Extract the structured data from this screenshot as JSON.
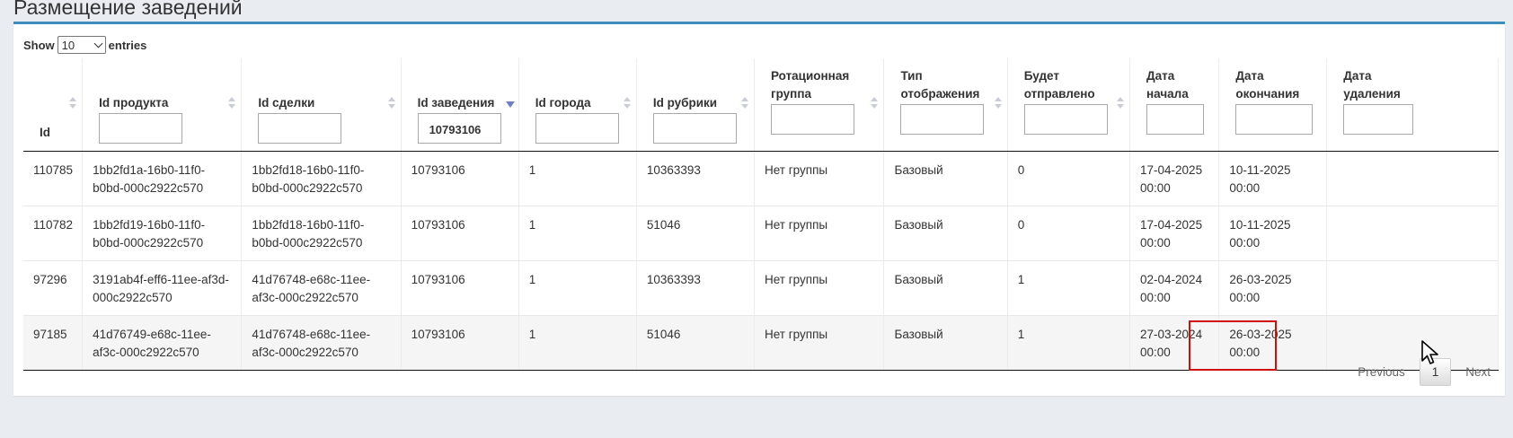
{
  "page": {
    "title": "Размещение заведений"
  },
  "length": {
    "show": "Show",
    "value": "10",
    "entries": "entries"
  },
  "table": {
    "columns": [
      {
        "label": "Id",
        "filter": null
      },
      {
        "label": "Id продукта",
        "filter": ""
      },
      {
        "label": "Id сделки",
        "filter": ""
      },
      {
        "label": "Id заведения",
        "filter": "10793106"
      },
      {
        "label": "Id города",
        "filter": ""
      },
      {
        "label": "Id рубрики",
        "filter": ""
      },
      {
        "label": "Ротационная группа",
        "filter": ""
      },
      {
        "label": "Тип отображения",
        "filter": ""
      },
      {
        "label": "Будет отправлено",
        "filter": ""
      },
      {
        "label": "Дата начала",
        "filter": ""
      },
      {
        "label": "Дата окончания",
        "filter": ""
      },
      {
        "label": "Дата удаления",
        "filter": ""
      }
    ],
    "rows": [
      [
        "110785",
        "1bb2fd1a-16b0-11f0-b0bd-000c2922c570",
        "1bb2fd18-16b0-11f0-b0bd-000c2922c570",
        "10793106",
        "1",
        "10363393",
        "Нет группы",
        "Базовый",
        "0",
        "17-04-2025 00:00",
        "10-11-2025 00:00",
        ""
      ],
      [
        "110782",
        "1bb2fd19-16b0-11f0-b0bd-000c2922c570",
        "1bb2fd18-16b0-11f0-b0bd-000c2922c570",
        "10793106",
        "1",
        "51046",
        "Нет группы",
        "Базовый",
        "0",
        "17-04-2025 00:00",
        "10-11-2025 00:00",
        ""
      ],
      [
        "97296",
        "3191ab4f-eff6-11ee-af3d-000c2922c570",
        "41d76748-e68c-11ee-af3c-000c2922c570",
        "10793106",
        "1",
        "10363393",
        "Нет группы",
        "Базовый",
        "1",
        "02-04-2024 00:00",
        "26-03-2025 00:00",
        ""
      ],
      [
        "97185",
        "41d76749-e68c-11ee-af3c-000c2922c570",
        "41d76748-e68c-11ee-af3c-000c2922c570",
        "10793106",
        "1",
        "51046",
        "Нет группы",
        "Базовый",
        "1",
        "27-03-2024 00:00",
        "26-03-2025 00:00",
        ""
      ]
    ]
  },
  "pagination": {
    "previous": "Previous",
    "current": "1",
    "next": "Next"
  },
  "colors": {
    "accent": "#3c8dbc",
    "highlight": "#d10d0d",
    "sort_active": "#6f7fc4"
  }
}
